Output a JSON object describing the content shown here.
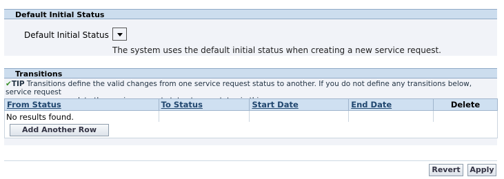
{
  "sections": {
    "default_status": {
      "title": "Default Initial Status",
      "field_label": "Default Initial Status",
      "description": "The system uses the default initial status when creating a new service request."
    },
    "transitions": {
      "title": "Transitions",
      "tip_label": "TIP",
      "tip_line1": "Transitions define the valid changes from one service request status to another. If you do not define any transitions below, service request",
      "tip_line2": "users can update the service request status to any status in this group.",
      "columns": [
        "From Status",
        "To Status",
        "Start Date",
        "End Date",
        "Delete"
      ],
      "empty_message": "No results found.",
      "add_row_label": "Add Another Row"
    }
  },
  "footer": {
    "revert_label": "Revert",
    "apply_label": "Apply"
  },
  "icons": {
    "tip": "checkmark-icon",
    "dropdown": "chevron-down-icon"
  },
  "colors": {
    "header_bg": "#ccddee",
    "region_bg": "#f1f3f8",
    "column_header_bg": "#cfe0f1",
    "tip_check": "#3a8f2b"
  }
}
